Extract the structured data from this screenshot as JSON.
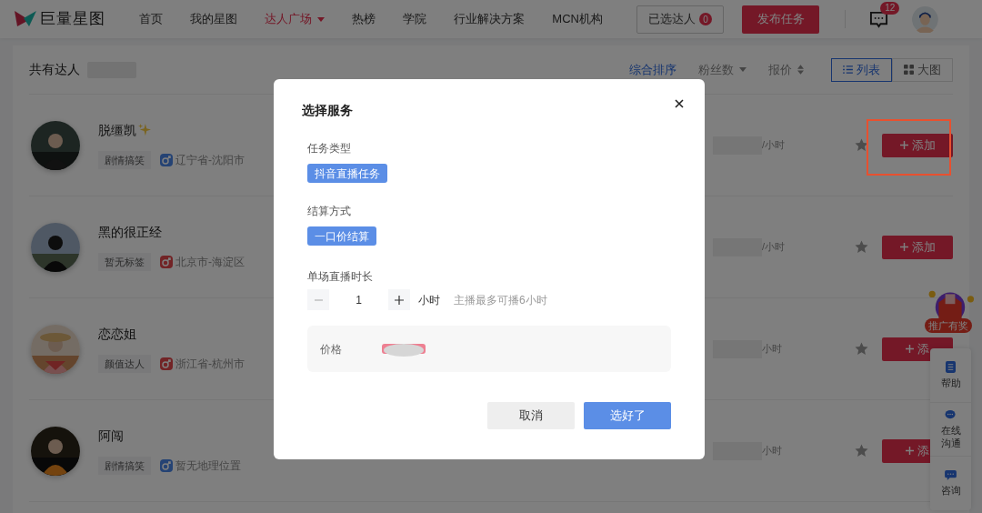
{
  "header": {
    "logo": "巨量星图",
    "nav": [
      {
        "label": "首页",
        "selected": false,
        "dropdown": false
      },
      {
        "label": "我的星图",
        "selected": false,
        "dropdown": false
      },
      {
        "label": "达人广场",
        "selected": true,
        "dropdown": true
      },
      {
        "label": "热榜",
        "selected": false,
        "dropdown": false
      },
      {
        "label": "学院",
        "selected": false,
        "dropdown": false
      },
      {
        "label": "行业解决方案",
        "selected": false,
        "dropdown": false
      },
      {
        "label": "MCN机构",
        "selected": false,
        "dropdown": false
      }
    ],
    "selected_button": {
      "label": "已选达人",
      "count": "0"
    },
    "publish_button": "发布任务",
    "messages_badge": "12"
  },
  "toolbar": {
    "title": "共有达人",
    "sort_options": [
      {
        "label": "综合排序",
        "selected": true,
        "kind": "plain"
      },
      {
        "label": "粉丝数",
        "selected": false,
        "kind": "dropdown"
      },
      {
        "label": "报价",
        "selected": false,
        "kind": "sort"
      }
    ],
    "view_tabs": [
      {
        "label": "列表",
        "selected": true,
        "kind": "list"
      },
      {
        "label": "大图",
        "selected": false,
        "kind": "grid"
      }
    ]
  },
  "creators": [
    {
      "name": "脱缰凯",
      "sparkle": true,
      "tag": "剧情搞笑",
      "location": "辽宁省-沈阳市",
      "kind": "male",
      "price_unit": "/小时",
      "add_label": "添加"
    },
    {
      "name": "黑的很正经",
      "sparkle": false,
      "tag": "暂无标签",
      "location": "北京市-海淀区",
      "kind": "female",
      "price_unit": "/小时",
      "add_label": "添加"
    },
    {
      "name": "恋恋姐",
      "sparkle": false,
      "tag": "颜值达人",
      "location": "浙江省-杭州市",
      "kind": "female",
      "price_unit": "小时",
      "add_label": "添"
    },
    {
      "name": "阿闯",
      "sparkle": false,
      "tag": "剧情搞笑",
      "location": "暂无地理位置",
      "kind": "male",
      "price_unit": "小时",
      "add_label": "添"
    }
  ],
  "side_widget": {
    "promo": "推广有奖",
    "items": [
      {
        "label": "帮助",
        "kind": "doc"
      },
      {
        "label": "在线沟通",
        "kind": "chat"
      },
      {
        "label": "咨询",
        "kind": "message"
      }
    ]
  },
  "dialog": {
    "title": "选择服务",
    "sections": [
      {
        "label": "任务类型",
        "options": [
          {
            "label": "抖音直播任务",
            "selected": true
          }
        ]
      },
      {
        "label": "结算方式",
        "options": [
          {
            "label": "一口价结算",
            "selected": true
          }
        ]
      }
    ],
    "duration": {
      "label": "单场直播时长",
      "value": "1",
      "unit": "小时",
      "hint": "主播最多可播6小时"
    },
    "price_label": "价格",
    "buttons": [
      {
        "label": "取消",
        "kind": "secondary"
      },
      {
        "label": "选好了",
        "kind": "primary"
      }
    ]
  }
}
